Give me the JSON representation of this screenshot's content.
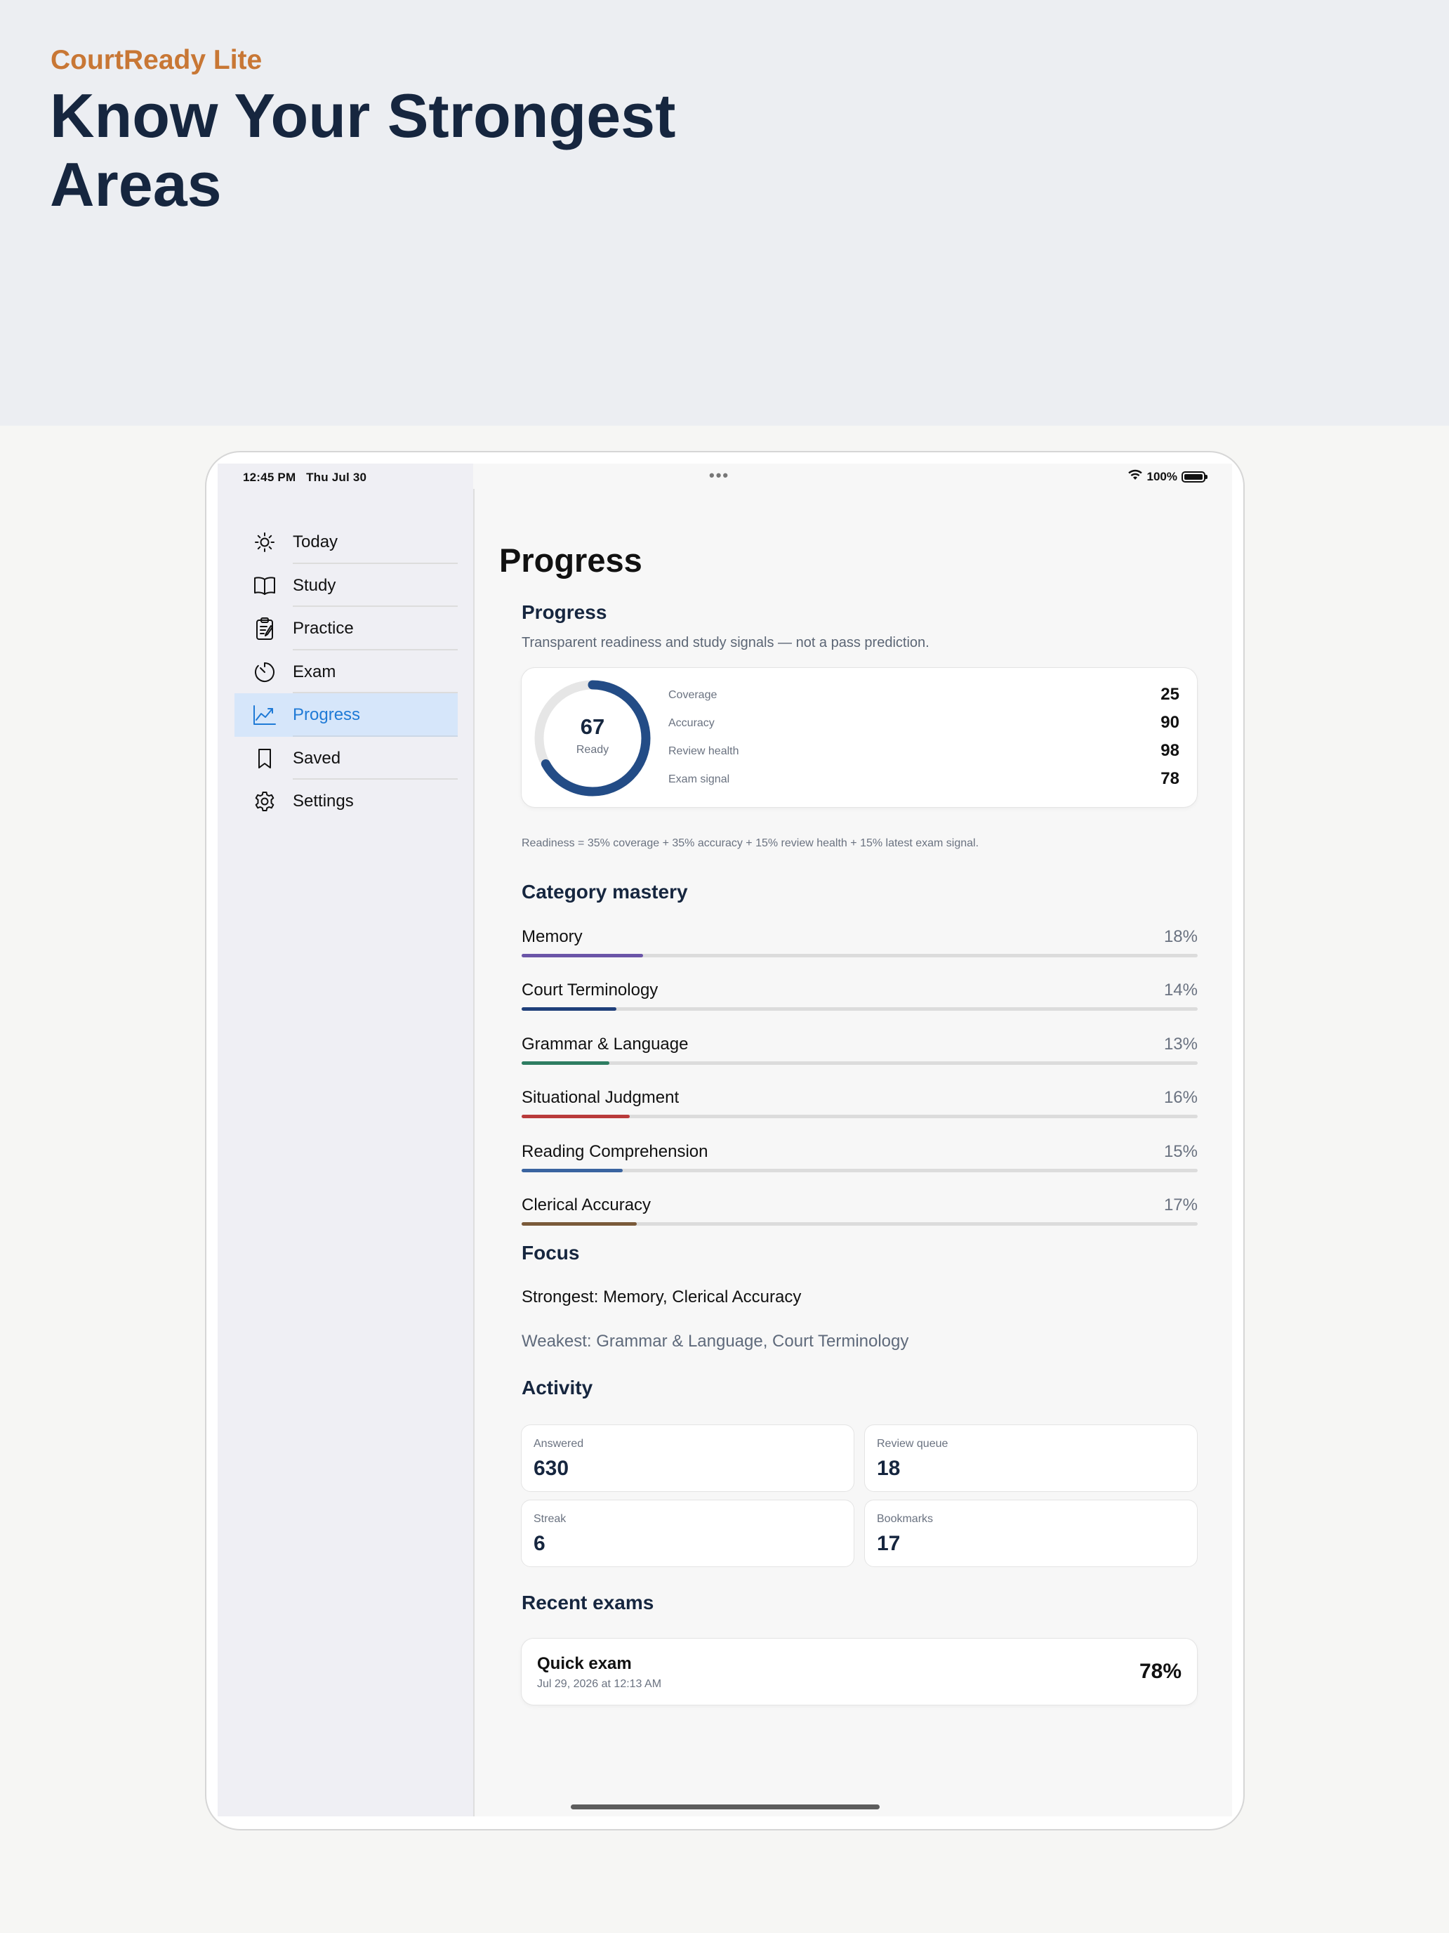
{
  "hero": {
    "brand": "CourtReady Lite",
    "title": "Know Your Strongest Areas"
  },
  "status_bar": {
    "time": "12:45 PM",
    "date": "Thu Jul 30",
    "battery": "100%",
    "icons": [
      "wifi-icon",
      "battery-icon"
    ]
  },
  "sidebar": {
    "items": [
      {
        "label": "Today",
        "icon": "sun-icon"
      },
      {
        "label": "Study",
        "icon": "book-icon"
      },
      {
        "label": "Practice",
        "icon": "clipboard-icon"
      },
      {
        "label": "Exam",
        "icon": "timer-icon"
      },
      {
        "label": "Progress",
        "icon": "chart-line-icon",
        "active": true
      },
      {
        "label": "Saved",
        "icon": "bookmark-icon"
      },
      {
        "label": "Settings",
        "icon": "gear-icon"
      }
    ]
  },
  "main": {
    "page_title": "Progress",
    "section_title": "Progress",
    "subtitle": "Transparent readiness and study signals — not a pass prediction.",
    "readiness": {
      "score": "67",
      "label": "Ready",
      "fraction": 0.67,
      "metrics": [
        {
          "label": "Coverage",
          "value": "25"
        },
        {
          "label": "Accuracy",
          "value": "90"
        },
        {
          "label": "Review health",
          "value": "98"
        },
        {
          "label": "Exam signal",
          "value": "78"
        }
      ]
    },
    "formula": "Readiness = 35% coverage + 35% accuracy + 15% review health + 15% latest exam signal.",
    "category_title": "Category mastery",
    "categories": [
      {
        "label": "Memory",
        "value": "18%",
        "pct": 18,
        "color": "#6b55a8"
      },
      {
        "label": "Court Terminology",
        "value": "14%",
        "pct": 14,
        "color": "#1f3f7a"
      },
      {
        "label": "Grammar & Language",
        "value": "13%",
        "pct": 13,
        "color": "#2e7d62"
      },
      {
        "label": "Situational Judgment",
        "value": "16%",
        "pct": 16,
        "color": "#b93b3b"
      },
      {
        "label": "Reading Comprehension",
        "value": "15%",
        "pct": 15,
        "color": "#3a64a0"
      },
      {
        "label": "Clerical Accuracy",
        "value": "17%",
        "pct": 17,
        "color": "#7a5a3a"
      }
    ],
    "focus_title": "Focus",
    "focus_strongest": "Strongest: Memory, Clerical Accuracy",
    "focus_weakest": "Weakest: Grammar & Language, Court Terminology",
    "activity_title": "Activity",
    "activity": [
      {
        "label": "Answered",
        "value": "630"
      },
      {
        "label": "Review queue",
        "value": "18"
      },
      {
        "label": "Streak",
        "value": "6"
      },
      {
        "label": "Bookmarks",
        "value": "17"
      }
    ],
    "recent_title": "Recent exams",
    "recent_exams": [
      {
        "title": "Quick exam",
        "date": "Jul 29, 2026 at 12:13 AM",
        "score": "78%"
      }
    ]
  },
  "colors": {
    "brand": "#c87735",
    "navy": "#16263f",
    "ring": "#234c86",
    "ring_track": "#e6e6e6",
    "active_nav_bg": "#d6e6fa",
    "active_nav_text": "#1f7ad6"
  }
}
